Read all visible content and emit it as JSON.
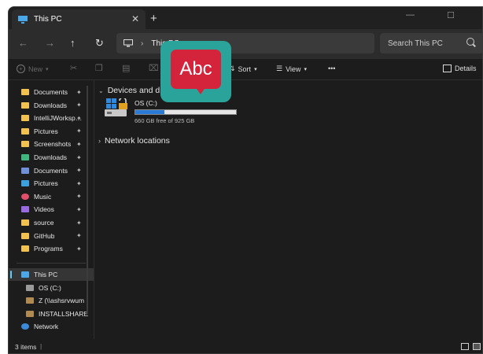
{
  "window": {
    "tab_title": "This PC",
    "tab_close": "✕",
    "new_tab": "+",
    "minimize": "—",
    "maximize": "☐",
    "close": "✕"
  },
  "nav": {
    "back": "←",
    "forward": "→",
    "up": "↑",
    "refresh": "↻",
    "address_segment": "This PC",
    "address_sep": "›",
    "search_placeholder": "Search This PC"
  },
  "commands": {
    "new": "New",
    "sort": "Sort",
    "view": "View",
    "more": "•••",
    "details": "Details"
  },
  "sidebar": {
    "items": [
      {
        "label": "Documents",
        "icon": "folder-icon",
        "pinned": true
      },
      {
        "label": "Downloads",
        "icon": "folder-icon",
        "pinned": true
      },
      {
        "label": "IntelliJWorksp…",
        "icon": "folder-icon",
        "pinned": true
      },
      {
        "label": "Pictures",
        "icon": "folder-icon",
        "pinned": true
      },
      {
        "label": "Screenshots",
        "icon": "folder-icon",
        "pinned": true
      },
      {
        "label": "Downloads",
        "icon": "download-icon",
        "pinned": true
      },
      {
        "label": "Documents",
        "icon": "document-icon",
        "pinned": true
      },
      {
        "label": "Pictures",
        "icon": "picture-icon",
        "pinned": true
      },
      {
        "label": "Music",
        "icon": "music-icon",
        "pinned": true
      },
      {
        "label": "Videos",
        "icon": "video-icon",
        "pinned": true
      },
      {
        "label": "source",
        "icon": "folder-icon",
        "pinned": true
      },
      {
        "label": "GitHub",
        "icon": "folder-icon",
        "pinned": true
      },
      {
        "label": "Programs",
        "icon": "folder-icon",
        "pinned": true
      }
    ],
    "tree": [
      {
        "label": "This PC",
        "icon": "computer-icon",
        "selected": true
      },
      {
        "label": "OS (C:)",
        "icon": "drive-icon"
      },
      {
        "label": "Z (\\\\ashsrvwum",
        "icon": "network-drive-icon"
      },
      {
        "label": "INSTALLSHARE",
        "icon": "network-drive-icon"
      },
      {
        "label": "Network",
        "icon": "network-icon"
      }
    ],
    "pin_glyph": "📌"
  },
  "main": {
    "devices_header": "Devices and drives",
    "network_header": "Network locations",
    "drive": {
      "name": "OS (C:)",
      "free_text": "660 GB free of 925 GB",
      "used_fraction": 0.2865
    }
  },
  "status": {
    "items_count": "3 items",
    "cursor": "|"
  },
  "overlay": {
    "text": "Abc"
  },
  "colors": {
    "accent": "#60cdff",
    "folder": "#f2c14e",
    "drive_fill": "#2b7ad6",
    "overlay_bg": "#2aa39a",
    "overlay_box": "#d4243b"
  }
}
